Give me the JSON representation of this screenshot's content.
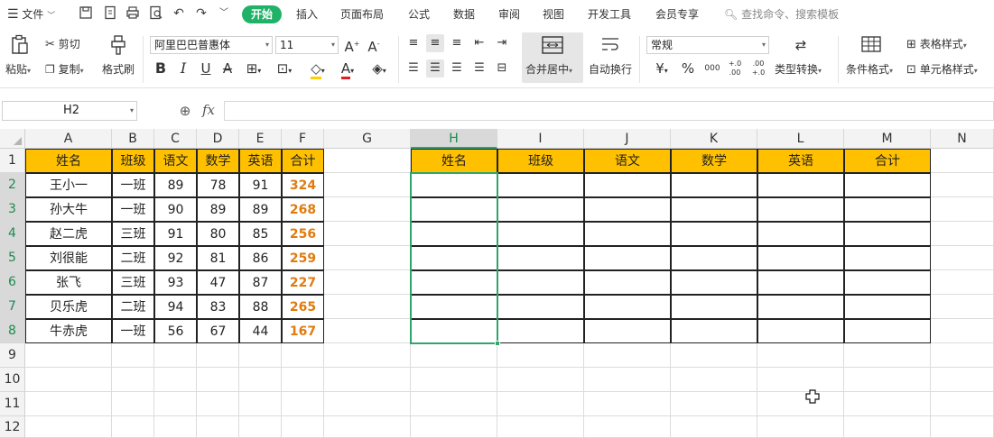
{
  "menu": {
    "file_label": "文件",
    "tabs": [
      "开始",
      "插入",
      "页面布局",
      "公式",
      "数据",
      "审阅",
      "视图",
      "开发工具",
      "会员专享"
    ],
    "active_tab": "开始",
    "search_placeholder": "查找命令、搜索模板"
  },
  "ribbon": {
    "paste": "粘贴",
    "cut": "剪切",
    "copy": "复制",
    "format_painter": "格式刷",
    "font_name": "阿里巴巴普惠体",
    "font_size": "11",
    "bold": "B",
    "italic": "I",
    "underline": "U",
    "merge_center": "合并居中",
    "wrap_text": "自动换行",
    "number_format": "常规",
    "currency": "¥",
    "percent": "%",
    "thousands": "000",
    "dec_increase": "+.0 .00",
    "dec_decrease": ".00 +.0",
    "convert_type": "类型转换",
    "conditional_format": "条件格式",
    "table_style": "表格样式",
    "cell_style": "单元格样式"
  },
  "formula_bar": {
    "name_box": "H2",
    "fx": "fx",
    "content": ""
  },
  "grid": {
    "columns": [
      "A",
      "B",
      "C",
      "D",
      "E",
      "F",
      "G",
      "H",
      "I",
      "J",
      "K",
      "L",
      "M",
      "N"
    ],
    "active_column": "H",
    "rows": [
      "1",
      "2",
      "3",
      "4",
      "5",
      "6",
      "7",
      "8",
      "9",
      "10",
      "11",
      "12"
    ],
    "active_rows": [
      "2",
      "3",
      "4",
      "5",
      "6",
      "7",
      "8"
    ],
    "source_table": {
      "headers": [
        "姓名",
        "班级",
        "语文",
        "数学",
        "英语",
        "合计"
      ],
      "rows": [
        [
          "王小一",
          "一班",
          "89",
          "78",
          "91",
          "324"
        ],
        [
          "孙大牛",
          "一班",
          "90",
          "89",
          "89",
          "268"
        ],
        [
          "赵二虎",
          "三班",
          "91",
          "80",
          "85",
          "256"
        ],
        [
          "刘很能",
          "二班",
          "92",
          "81",
          "86",
          "259"
        ],
        [
          "张飞",
          "三班",
          "93",
          "47",
          "87",
          "227"
        ],
        [
          "贝乐虎",
          "二班",
          "94",
          "83",
          "88",
          "265"
        ],
        [
          "牛赤虎",
          "一班",
          "56",
          "67",
          "44",
          "167"
        ]
      ]
    },
    "target_table": {
      "headers": [
        "姓名",
        "班级",
        "语文",
        "数学",
        "英语",
        "合计"
      ]
    }
  },
  "colors": {
    "header_fill": "#ffc000",
    "total_text": "#e07b10",
    "accent": "#20b368"
  }
}
